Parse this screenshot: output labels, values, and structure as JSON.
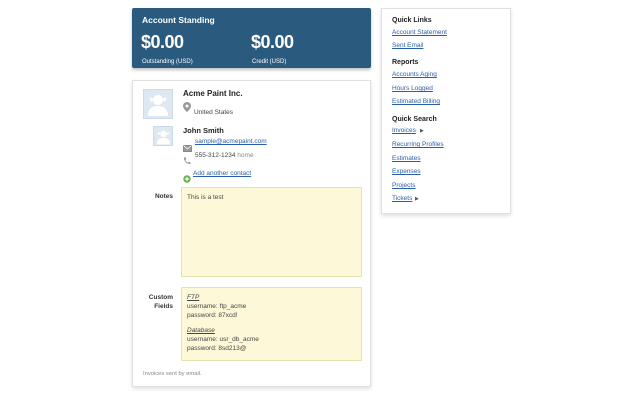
{
  "standing": {
    "title": "Account Standing",
    "outstanding_amount": "$0.00",
    "outstanding_caption": "Outstanding (USD)",
    "credit_amount": "$0.00",
    "credit_caption": "Credit (USD)",
    "bg_color": "#2b5a7f"
  },
  "client": {
    "company": "Acme Paint Inc.",
    "country": "United States"
  },
  "contact": {
    "name": "John Smith",
    "email": "sample@acmepaint.com",
    "phone": "555-312-1234",
    "phone_type": "home",
    "add_label": "Add another contact"
  },
  "notes": {
    "label": "Notes",
    "text": "This is a test"
  },
  "custom_fields": {
    "label_line1": "Custom",
    "label_line2": "Fields",
    "groups": [
      {
        "heading": "FTP",
        "lines": [
          "username: ftp_acme",
          "password: 87xcd!"
        ]
      },
      {
        "heading": "Database",
        "lines": [
          "username: usr_db_acme",
          "password: 8sd213@"
        ]
      }
    ]
  },
  "footnote": "Invoices sent by email.",
  "sidebar": {
    "quick_links": {
      "heading": "Quick Links",
      "items": [
        "Account Statement",
        "Sent Email"
      ]
    },
    "reports": {
      "heading": "Reports",
      "items": [
        "Accounts Aging",
        "Hours Logged",
        "Estimated Billing"
      ]
    },
    "quick_search": {
      "heading": "Quick Search",
      "items": [
        "Invoices",
        "Recurring Profiles",
        "Estimates",
        "Expenses",
        "Projects",
        "Tickets"
      ]
    }
  },
  "colors": {
    "link": "#2a5fa8",
    "note_bg": "#fdf9d8"
  },
  "icons": {
    "avatar": "person-silhouette-icon",
    "pin": "map-pin-icon",
    "email": "envelope-icon",
    "phone": "phone-icon",
    "add": "plus-circle-icon",
    "arrow": "triangle-right-icon"
  }
}
